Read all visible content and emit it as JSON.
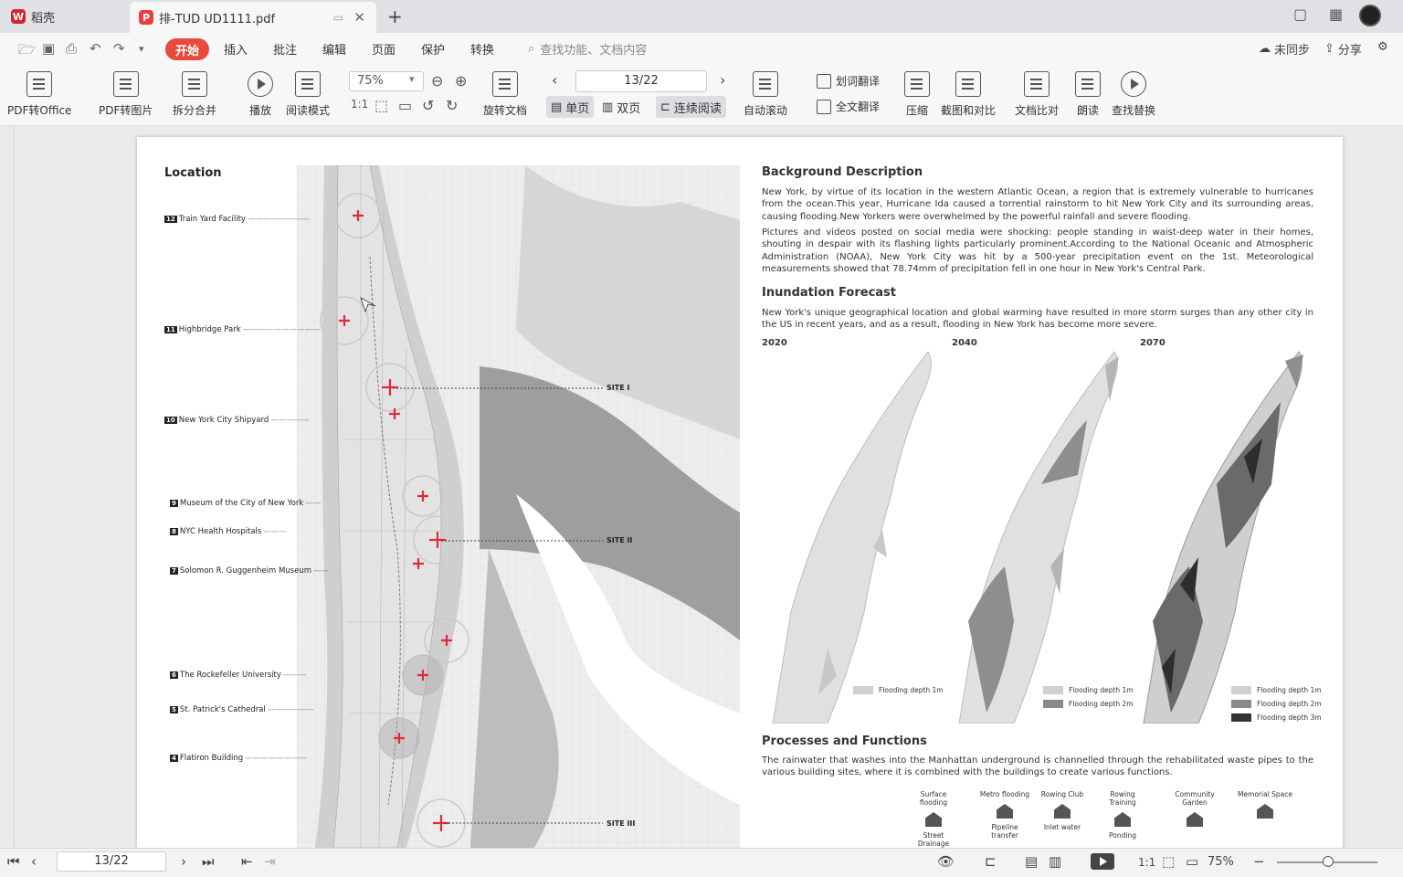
{
  "tabs": {
    "home_label": "稻壳",
    "doc_label": "排-TUD UD1111.pdf",
    "add_label": "+",
    "close_label": "✕"
  },
  "menu": {
    "start": "开始",
    "items": [
      "插入",
      "批注",
      "编辑",
      "页面",
      "保护",
      "转换"
    ],
    "search_placeholder": "查找功能、文档内容",
    "sync": "未同步",
    "share": "分享"
  },
  "toolbar": {
    "pdf_to_office": "PDF转Office",
    "pdf_to_image": "PDF转图片",
    "split_merge": "拆分合并",
    "play": "播放",
    "read_mode": "阅读模式",
    "zoom": "75%",
    "rotate": "旋转文档",
    "page_indicator": "13/22",
    "single_page": "单页",
    "double_page": "双页",
    "continuous": "连续阅读",
    "auto_scroll": "自动滚动",
    "word_translate": "划词翻译",
    "full_translate": "全文翻译",
    "compress": "压缩",
    "screenshot_compare": "截图和对比",
    "doc_compare": "文档比对",
    "read_aloud": "朗读",
    "find_replace": "查找替换"
  },
  "document": {
    "location_title": "Location",
    "landmarks": [
      {
        "num": "12",
        "name": "Train Yard Facility"
      },
      {
        "num": "11",
        "name": "Highbridge Park"
      },
      {
        "num": "10",
        "name": "New York City Shipyard"
      },
      {
        "num": "9",
        "name": "Museum of the City of New York"
      },
      {
        "num": "8",
        "name": "NYC Health Hospitals"
      },
      {
        "num": "7",
        "name": "Solomon R. Guggenheim Museum"
      },
      {
        "num": "6",
        "name": "The Rockefeller University"
      },
      {
        "num": "5",
        "name": "St. Patrick's Cathedral"
      },
      {
        "num": "4",
        "name": "Flatiron Building"
      }
    ],
    "sites": [
      "SITE I",
      "SITE II",
      "SITE III"
    ],
    "background_title": "Background Description",
    "background_p1": "New York, by virtue of its location in the western Atlantic Ocean, a region that is extremely vulnerable to hurricanes from the ocean.This year, Hurricane Ida caused a torrential rainstorm to hit New York City and its surrounding areas, causing flooding.New Yorkers were overwhelmed by the powerful rainfall and severe flooding.",
    "background_p2": "Pictures and videos posted on social media were shocking: people standing in waist-deep water in their homes, shouting in despair with its flashing lights particularly prominent.According to the National Oceanic and Atmospheric Administration (NOAA), New York City was hit by a 500-year precipitation event on the 1st. Meteorological measurements showed that 78.74mm of precipitation fell in one hour in New York's Central Park.",
    "inundation_title": "Inundation Forecast",
    "inundation_p": "New York's unique geographical location and global warming have resulted in more storm surges than any other city in the US in recent years, and as a result, flooding in New York has become more severe.",
    "years": [
      "2020",
      "2040",
      "2070"
    ],
    "legend_1m": "Flooding depth 1m",
    "legend_2m": "Flooding depth 2m",
    "legend_3m": "Flooding depth 3m",
    "processes_title": "Processes and Functions",
    "processes_p": "The rainwater that washes into the Manhattan underground is channelled through the rehabilitated waste pipes to the various building sites, where it is combined with the buildings to create various functions.",
    "functions": [
      {
        "top": "Surface flooding",
        "bottom": "Street Drainage"
      },
      {
        "top": "Metro flooding",
        "bottom": "Pipeline transfer"
      },
      {
        "top": "Rowing Club",
        "bottom": "Inlet water"
      },
      {
        "top": "Rowing Training",
        "bottom": "Ponding"
      },
      {
        "top": "Community Garden",
        "bottom": ""
      },
      {
        "top": "Memorial Space",
        "bottom": ""
      }
    ]
  },
  "statusbar": {
    "page": "13/22",
    "zoom": "75%"
  }
}
